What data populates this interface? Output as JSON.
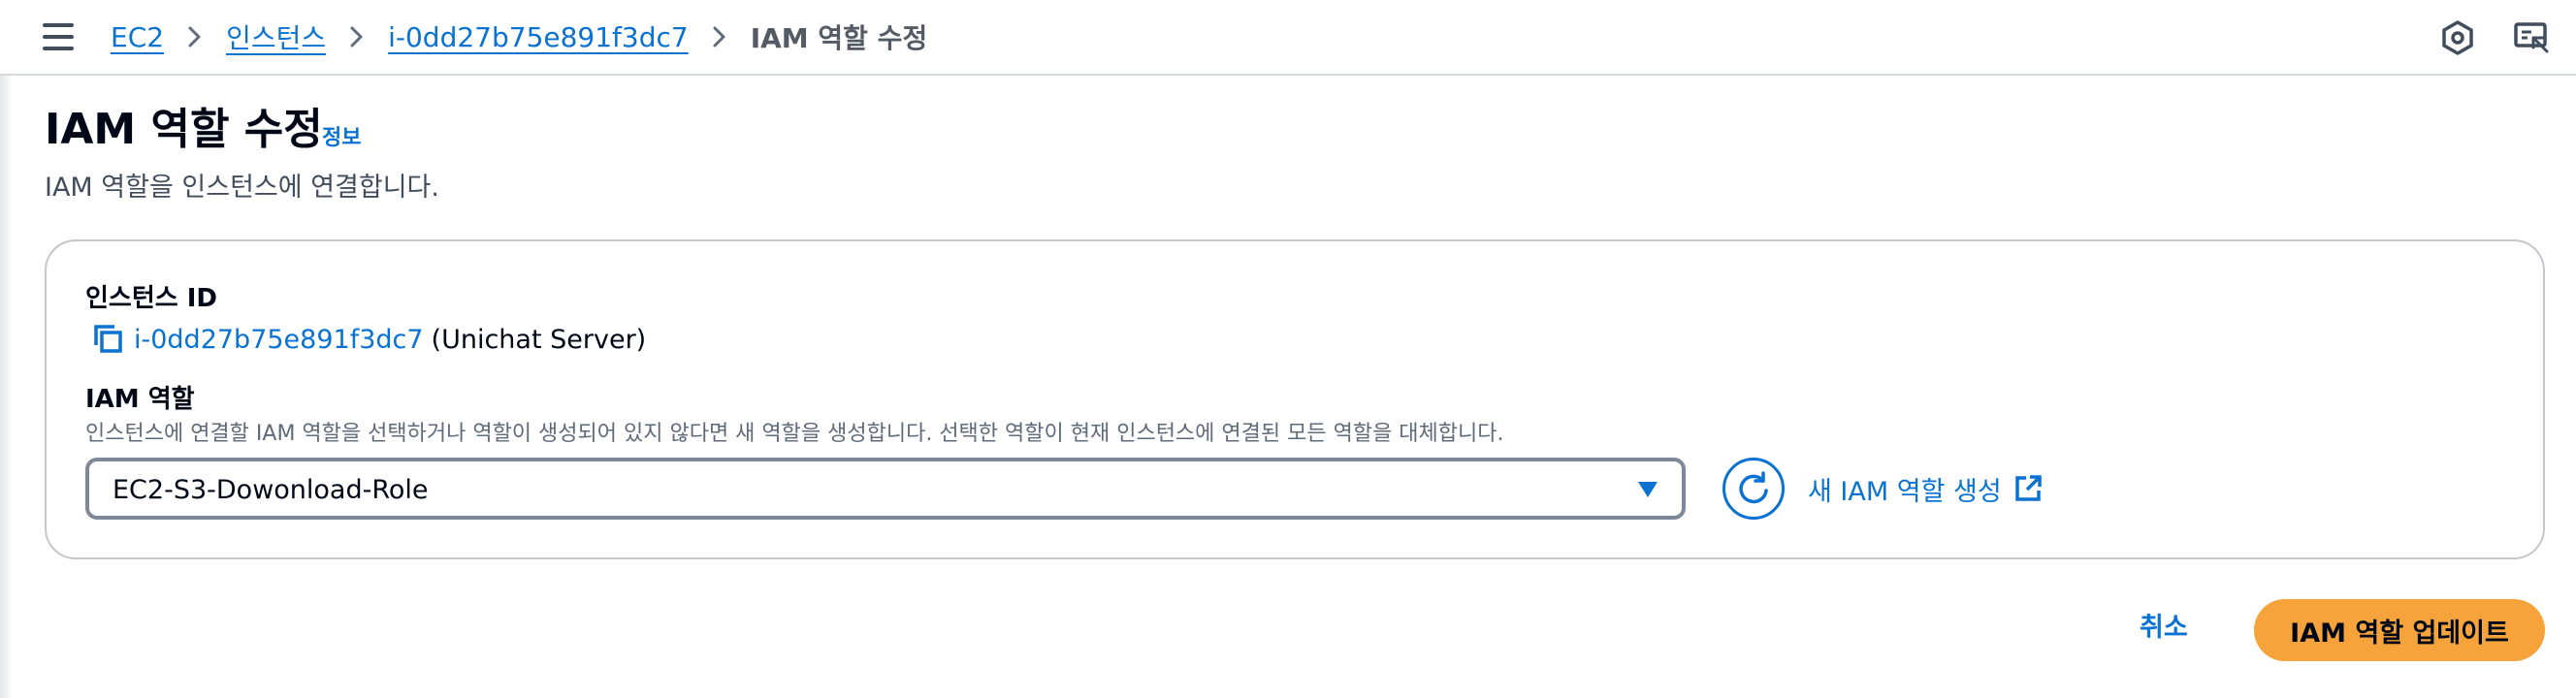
{
  "breadcrumb": {
    "items": [
      {
        "label": "EC2"
      },
      {
        "label": "인스턴스"
      },
      {
        "label": "i-0dd27b75e891f3dc7"
      }
    ],
    "current": "IAM 역할 수정"
  },
  "topbar": {
    "icons": [
      "settings-hex-icon",
      "feedback-icon"
    ]
  },
  "header": {
    "title": "IAM 역할 수정",
    "info_link": "정보",
    "description": "IAM 역할을 인스턴스에 연결합니다."
  },
  "instance": {
    "label": "인스턴스 ID",
    "id": "i-0dd27b75e891f3dc7",
    "name": "(Unichat Server)"
  },
  "iam_role": {
    "label": "IAM 역할",
    "description": "인스턴스에 연결할 IAM 역할을 선택하거나 역할이 생성되어 있지 않다면 새 역할을 생성합니다. 선택한 역할이 현재 인스턴스에 연결된 모든 역할을 대체합니다.",
    "selected": "EC2-S3-Dowonload-Role",
    "create_link": "새 IAM 역할 생성"
  },
  "actions": {
    "cancel": "취소",
    "submit": "IAM 역할 업데이트"
  },
  "colors": {
    "link": "#0972d3",
    "primary_button": "#f5a33a",
    "text": "#000716"
  }
}
